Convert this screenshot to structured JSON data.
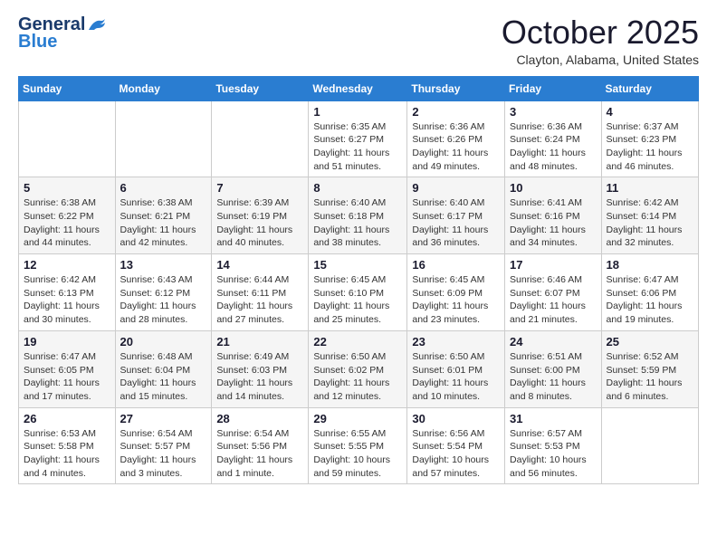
{
  "header": {
    "logo_general": "General",
    "logo_blue": "Blue",
    "month_title": "October 2025",
    "location": "Clayton, Alabama, United States"
  },
  "weekdays": [
    "Sunday",
    "Monday",
    "Tuesday",
    "Wednesday",
    "Thursday",
    "Friday",
    "Saturday"
  ],
  "weeks": [
    [
      {
        "day": "",
        "sunrise": "",
        "sunset": "",
        "daylight": ""
      },
      {
        "day": "",
        "sunrise": "",
        "sunset": "",
        "daylight": ""
      },
      {
        "day": "",
        "sunrise": "",
        "sunset": "",
        "daylight": ""
      },
      {
        "day": "1",
        "sunrise": "Sunrise: 6:35 AM",
        "sunset": "Sunset: 6:27 PM",
        "daylight": "Daylight: 11 hours and 51 minutes."
      },
      {
        "day": "2",
        "sunrise": "Sunrise: 6:36 AM",
        "sunset": "Sunset: 6:26 PM",
        "daylight": "Daylight: 11 hours and 49 minutes."
      },
      {
        "day": "3",
        "sunrise": "Sunrise: 6:36 AM",
        "sunset": "Sunset: 6:24 PM",
        "daylight": "Daylight: 11 hours and 48 minutes."
      },
      {
        "day": "4",
        "sunrise": "Sunrise: 6:37 AM",
        "sunset": "Sunset: 6:23 PM",
        "daylight": "Daylight: 11 hours and 46 minutes."
      }
    ],
    [
      {
        "day": "5",
        "sunrise": "Sunrise: 6:38 AM",
        "sunset": "Sunset: 6:22 PM",
        "daylight": "Daylight: 11 hours and 44 minutes."
      },
      {
        "day": "6",
        "sunrise": "Sunrise: 6:38 AM",
        "sunset": "Sunset: 6:21 PM",
        "daylight": "Daylight: 11 hours and 42 minutes."
      },
      {
        "day": "7",
        "sunrise": "Sunrise: 6:39 AM",
        "sunset": "Sunset: 6:19 PM",
        "daylight": "Daylight: 11 hours and 40 minutes."
      },
      {
        "day": "8",
        "sunrise": "Sunrise: 6:40 AM",
        "sunset": "Sunset: 6:18 PM",
        "daylight": "Daylight: 11 hours and 38 minutes."
      },
      {
        "day": "9",
        "sunrise": "Sunrise: 6:40 AM",
        "sunset": "Sunset: 6:17 PM",
        "daylight": "Daylight: 11 hours and 36 minutes."
      },
      {
        "day": "10",
        "sunrise": "Sunrise: 6:41 AM",
        "sunset": "Sunset: 6:16 PM",
        "daylight": "Daylight: 11 hours and 34 minutes."
      },
      {
        "day": "11",
        "sunrise": "Sunrise: 6:42 AM",
        "sunset": "Sunset: 6:14 PM",
        "daylight": "Daylight: 11 hours and 32 minutes."
      }
    ],
    [
      {
        "day": "12",
        "sunrise": "Sunrise: 6:42 AM",
        "sunset": "Sunset: 6:13 PM",
        "daylight": "Daylight: 11 hours and 30 minutes."
      },
      {
        "day": "13",
        "sunrise": "Sunrise: 6:43 AM",
        "sunset": "Sunset: 6:12 PM",
        "daylight": "Daylight: 11 hours and 28 minutes."
      },
      {
        "day": "14",
        "sunrise": "Sunrise: 6:44 AM",
        "sunset": "Sunset: 6:11 PM",
        "daylight": "Daylight: 11 hours and 27 minutes."
      },
      {
        "day": "15",
        "sunrise": "Sunrise: 6:45 AM",
        "sunset": "Sunset: 6:10 PM",
        "daylight": "Daylight: 11 hours and 25 minutes."
      },
      {
        "day": "16",
        "sunrise": "Sunrise: 6:45 AM",
        "sunset": "Sunset: 6:09 PM",
        "daylight": "Daylight: 11 hours and 23 minutes."
      },
      {
        "day": "17",
        "sunrise": "Sunrise: 6:46 AM",
        "sunset": "Sunset: 6:07 PM",
        "daylight": "Daylight: 11 hours and 21 minutes."
      },
      {
        "day": "18",
        "sunrise": "Sunrise: 6:47 AM",
        "sunset": "Sunset: 6:06 PM",
        "daylight": "Daylight: 11 hours and 19 minutes."
      }
    ],
    [
      {
        "day": "19",
        "sunrise": "Sunrise: 6:47 AM",
        "sunset": "Sunset: 6:05 PM",
        "daylight": "Daylight: 11 hours and 17 minutes."
      },
      {
        "day": "20",
        "sunrise": "Sunrise: 6:48 AM",
        "sunset": "Sunset: 6:04 PM",
        "daylight": "Daylight: 11 hours and 15 minutes."
      },
      {
        "day": "21",
        "sunrise": "Sunrise: 6:49 AM",
        "sunset": "Sunset: 6:03 PM",
        "daylight": "Daylight: 11 hours and 14 minutes."
      },
      {
        "day": "22",
        "sunrise": "Sunrise: 6:50 AM",
        "sunset": "Sunset: 6:02 PM",
        "daylight": "Daylight: 11 hours and 12 minutes."
      },
      {
        "day": "23",
        "sunrise": "Sunrise: 6:50 AM",
        "sunset": "Sunset: 6:01 PM",
        "daylight": "Daylight: 11 hours and 10 minutes."
      },
      {
        "day": "24",
        "sunrise": "Sunrise: 6:51 AM",
        "sunset": "Sunset: 6:00 PM",
        "daylight": "Daylight: 11 hours and 8 minutes."
      },
      {
        "day": "25",
        "sunrise": "Sunrise: 6:52 AM",
        "sunset": "Sunset: 5:59 PM",
        "daylight": "Daylight: 11 hours and 6 minutes."
      }
    ],
    [
      {
        "day": "26",
        "sunrise": "Sunrise: 6:53 AM",
        "sunset": "Sunset: 5:58 PM",
        "daylight": "Daylight: 11 hours and 4 minutes."
      },
      {
        "day": "27",
        "sunrise": "Sunrise: 6:54 AM",
        "sunset": "Sunset: 5:57 PM",
        "daylight": "Daylight: 11 hours and 3 minutes."
      },
      {
        "day": "28",
        "sunrise": "Sunrise: 6:54 AM",
        "sunset": "Sunset: 5:56 PM",
        "daylight": "Daylight: 11 hours and 1 minute."
      },
      {
        "day": "29",
        "sunrise": "Sunrise: 6:55 AM",
        "sunset": "Sunset: 5:55 PM",
        "daylight": "Daylight: 10 hours and 59 minutes."
      },
      {
        "day": "30",
        "sunrise": "Sunrise: 6:56 AM",
        "sunset": "Sunset: 5:54 PM",
        "daylight": "Daylight: 10 hours and 57 minutes."
      },
      {
        "day": "31",
        "sunrise": "Sunrise: 6:57 AM",
        "sunset": "Sunset: 5:53 PM",
        "daylight": "Daylight: 10 hours and 56 minutes."
      },
      {
        "day": "",
        "sunrise": "",
        "sunset": "",
        "daylight": ""
      }
    ]
  ]
}
